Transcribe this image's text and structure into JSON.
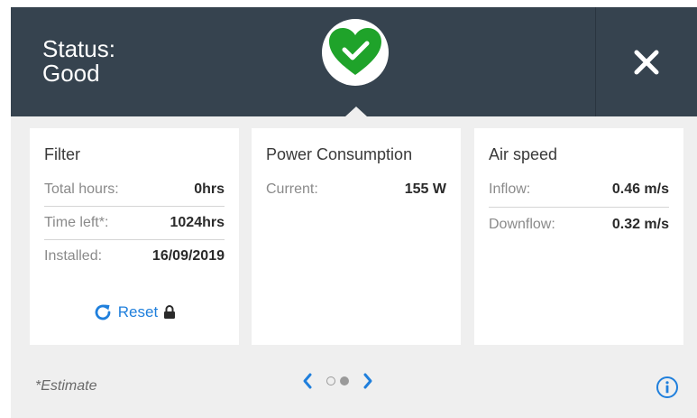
{
  "header": {
    "status_line1": "Status:",
    "status_line2": "Good",
    "status_icon": "heart-check-icon",
    "status_color": "#1fa32a",
    "close_icon": "close-icon"
  },
  "cards": {
    "filter": {
      "title": "Filter",
      "total_hours_label": "Total hours:",
      "total_hours_value": "0hrs",
      "time_left_label": "Time left*:",
      "time_left_value": "1024hrs",
      "installed_label": "Installed:",
      "installed_value": "16/09/2019",
      "reset_label": "Reset",
      "reset_icon": "refresh-icon",
      "lock_icon": "lock-icon"
    },
    "power": {
      "title": "Power Consumption",
      "current_label": "Current:",
      "current_value": "155 W"
    },
    "air": {
      "title": "Air speed",
      "inflow_label": "Inflow:",
      "inflow_value": "0.46 m/s",
      "downflow_label": "Downflow:",
      "downflow_value": "0.32 m/s"
    }
  },
  "footer": {
    "note": "*Estimate",
    "pager": {
      "pages": 2,
      "current": 2
    },
    "info_icon": "info-icon",
    "accent": "#1f7fdc"
  }
}
